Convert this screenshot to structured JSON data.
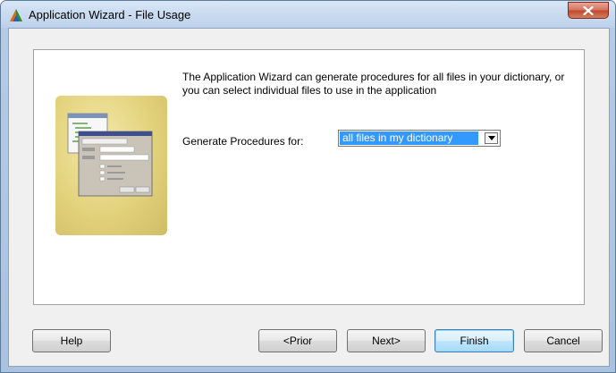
{
  "window": {
    "title": "Application Wizard - File Usage"
  },
  "description": "The Application Wizard can generate procedures for all files in your dictionary, or you can select individual files to use in the application",
  "generate": {
    "label": "Generate Procedures for:",
    "selected": "all files in my dictionary"
  },
  "buttons": {
    "help": "Help",
    "prior": "<Prior",
    "next": "Next>",
    "finish": "Finish",
    "cancel": "Cancel"
  },
  "colors": {
    "selection": "#3399ff",
    "close_button": "#c24a30",
    "frame": "#b4cbe6",
    "image_bg": "#e3d27c"
  },
  "icons": {
    "app": "triangle-app-icon",
    "close": "close-icon",
    "dropdown": "chevron-down-icon"
  }
}
